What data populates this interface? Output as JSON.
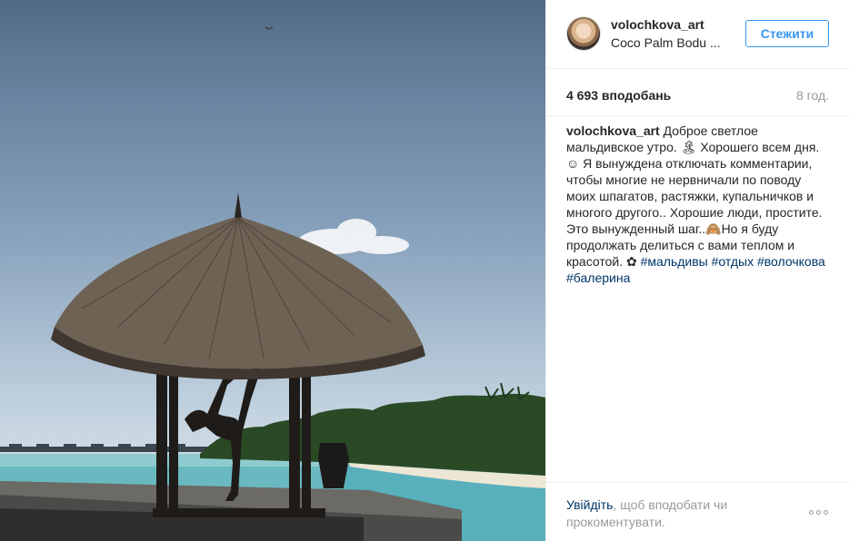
{
  "post": {
    "username": "volochkova_art",
    "location": "Coco Palm Bodu ...",
    "follow_label": "Стежити",
    "likes": "4 693 вподобань",
    "time": "8 год."
  },
  "caption": {
    "author": "volochkova_art",
    "text": " Доброе светлое мальдивское утро. 🏝 Хорошего всем дня. ☺ Я вынуждена отключать комментарии, чтобы многие не нервничали по поводу моих шпагатов, растяжки, купальничков и многого другого.. Хорошие люди, простите. Это вынужденный шаг..🙈Но я буду продолжать делиться с вами теплом и красотой. ✿ ",
    "tags": [
      "#мальдивы",
      "#отдых",
      "#волочкова",
      "#балерина"
    ]
  },
  "footer": {
    "login_link": "Увійдіть",
    "login_rest": ", щоб вподобати чи прокоментувати."
  },
  "icons": [
    "avatar",
    "more-options-icon"
  ]
}
